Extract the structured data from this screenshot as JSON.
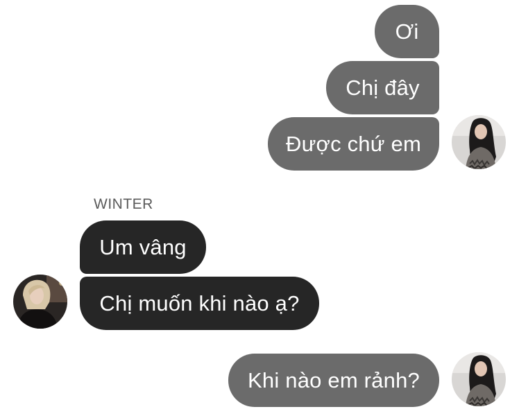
{
  "conversation": {
    "sender_name": "WINTER",
    "messages": [
      {
        "from": "me",
        "text": "Ơi"
      },
      {
        "from": "me",
        "text": "Chị đây"
      },
      {
        "from": "me",
        "text": "Được chứ em"
      },
      {
        "from": "them",
        "text": "Um vâng"
      },
      {
        "from": "them",
        "text": "Chị muốn khi nào ạ?"
      },
      {
        "from": "me",
        "text": "Khi nào em rảnh?"
      }
    ]
  },
  "avatars": {
    "me": {
      "icon": "profile-photo-dark-hair"
    },
    "them": {
      "icon": "profile-photo-blonde-hair"
    }
  },
  "colors": {
    "outgoing_bubble": "#6b6b6b",
    "incoming_bubble": "#262626",
    "bubble_text": "#ffffff",
    "sender_name": "#5a5a5a",
    "background": "#ffffff"
  }
}
